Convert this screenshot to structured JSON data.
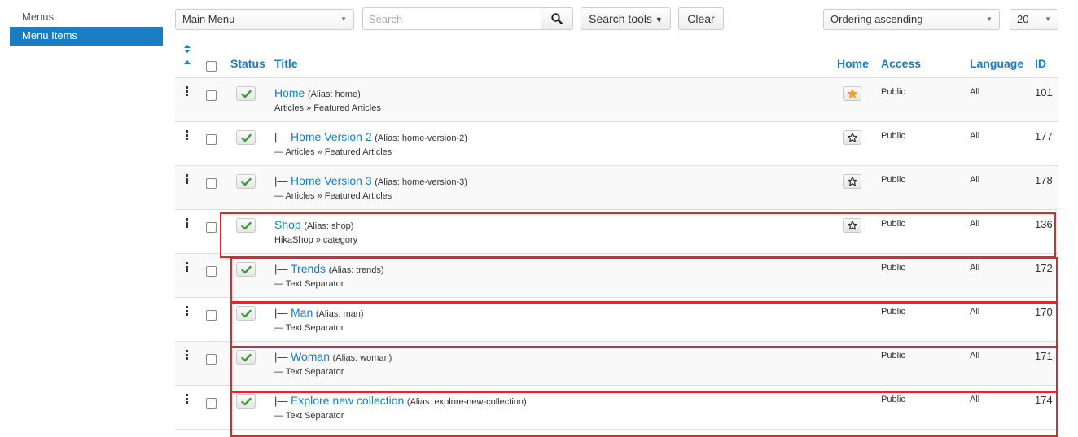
{
  "sidebar": {
    "items": [
      {
        "label": "Menus",
        "active": false
      },
      {
        "label": "Menu Items",
        "active": true
      }
    ]
  },
  "toolbar": {
    "menu_select": "Main Menu",
    "search_placeholder": "Search",
    "search_tools_label": "Search tools",
    "clear_label": "Clear",
    "ordering_select": "Ordering ascending",
    "limit_select": "20"
  },
  "table": {
    "headers": {
      "status": "Status",
      "title": "Title",
      "home": "Home",
      "access": "Access",
      "language": "Language",
      "id": "ID"
    },
    "rows": [
      {
        "tree": "",
        "title": "Home",
        "alias": "(Alias: home)",
        "subtitle": "Articles » Featured Articles",
        "home": "default",
        "access": "Public",
        "language": "All",
        "id": "101",
        "highlighted": false
      },
      {
        "tree": "|— ",
        "title": "Home Version 2",
        "alias": "(Alias: home-version-2)",
        "subtitle": "— Articles » Featured Articles",
        "home": "star",
        "access": "Public",
        "language": "All",
        "id": "177",
        "highlighted": false
      },
      {
        "tree": "|— ",
        "title": "Home Version 3",
        "alias": "(Alias: home-version-3)",
        "subtitle": "— Articles » Featured Articles",
        "home": "star",
        "access": "Public",
        "language": "All",
        "id": "178",
        "highlighted": false
      },
      {
        "tree": "",
        "title": "Shop",
        "alias": "(Alias: shop)",
        "subtitle": "HikaShop » category",
        "home": "star",
        "access": "Public",
        "language": "All",
        "id": "136",
        "highlighted": true
      },
      {
        "tree": "|— ",
        "title": "Trends",
        "alias": "(Alias: trends)",
        "subtitle": "— Text Separator",
        "home": "",
        "access": "Public",
        "language": "All",
        "id": "172",
        "highlighted": true
      },
      {
        "tree": "|— ",
        "title": "Man",
        "alias": "(Alias: man)",
        "subtitle": "— Text Separator",
        "home": "",
        "access": "Public",
        "language": "All",
        "id": "170",
        "highlighted": true
      },
      {
        "tree": "|— ",
        "title": "Woman",
        "alias": "(Alias: woman)",
        "subtitle": "— Text Separator",
        "home": "",
        "access": "Public",
        "language": "All",
        "id": "171",
        "highlighted": true
      },
      {
        "tree": "|— ",
        "title": "Explore new collection",
        "alias": "(Alias: explore-new-collection)",
        "subtitle": "— Text Separator",
        "home": "",
        "access": "Public",
        "language": "All",
        "id": "174",
        "highlighted": true
      }
    ]
  },
  "colors": {
    "link": "#1a7cc1",
    "active_sidebar": "#1a7cc1",
    "published_check": "#3c9b3c",
    "default_star": "#f0a030",
    "highlight_border": "#e3262b"
  },
  "icons": {
    "search": "magnifier-icon",
    "sort": "sort-arrows-icon",
    "drag": "drag-handle-icon",
    "published": "checkmark-icon",
    "home_default": "star-filled-icon",
    "home_set": "star-outline-icon"
  }
}
